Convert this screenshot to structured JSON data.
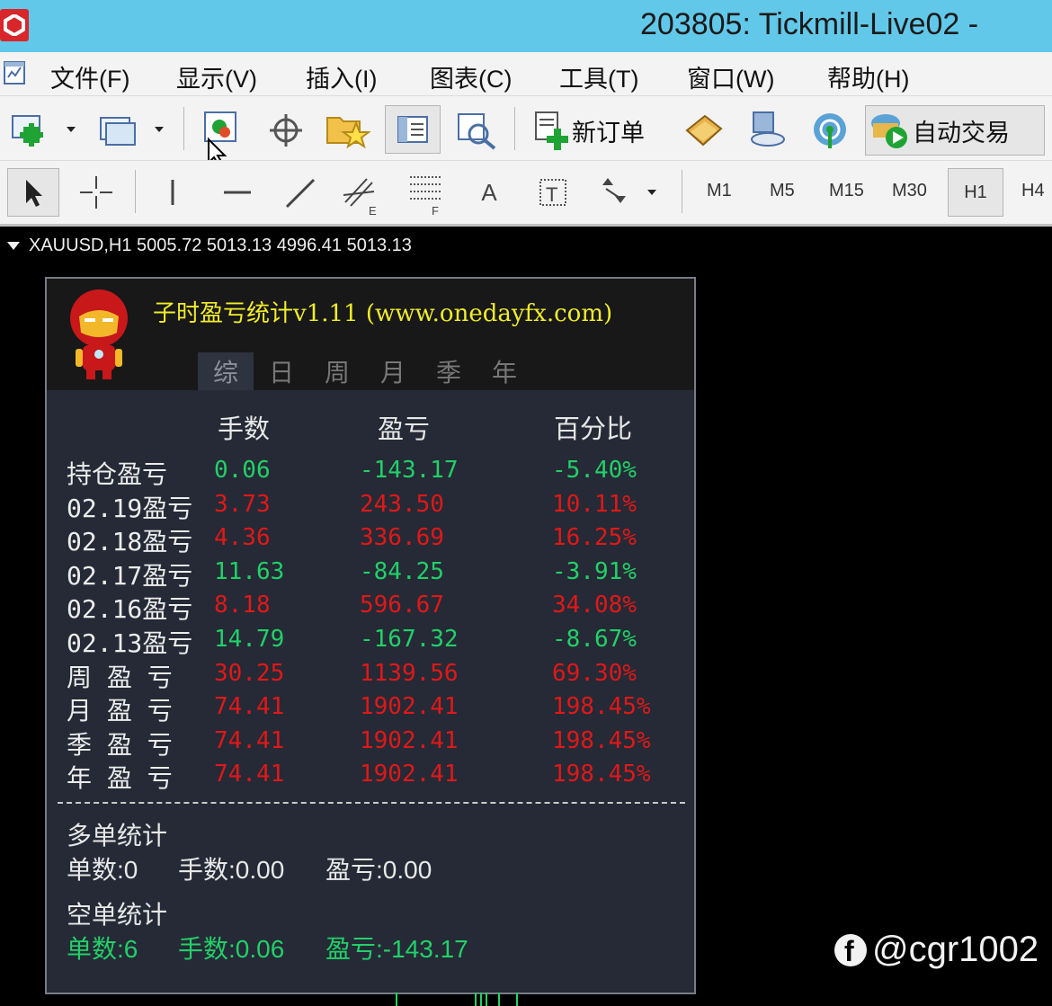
{
  "window": {
    "title": "203805: Tickmill-Live02 -"
  },
  "menu": {
    "items": [
      {
        "label": "文件(F)"
      },
      {
        "label": "显示(V)"
      },
      {
        "label": "插入(I)"
      },
      {
        "label": "图表(C)"
      },
      {
        "label": "工具(T)"
      },
      {
        "label": "窗口(W)"
      },
      {
        "label": "帮助(H)"
      }
    ]
  },
  "toolbar": {
    "new_order_label": "新订单",
    "auto_trade_label": "自动交易",
    "text_tool_label": "A",
    "timeframes": [
      "M1",
      "M5",
      "M15",
      "M30",
      "H1",
      "H4"
    ],
    "active_timeframe": "H1"
  },
  "chart": {
    "header": "XAUUSD,H1  5005.72 5013.13 4996.41 5013.13"
  },
  "panel": {
    "title": "子时盈亏统计v1.11 (www.onedayfx.com)",
    "tabs": [
      "综",
      "日",
      "周",
      "月",
      "季",
      "年"
    ],
    "active_tab": "综",
    "columns": [
      "手数",
      "盈亏",
      "百分比"
    ],
    "rows": [
      {
        "label": "持仓盈亏",
        "lots": "0.06",
        "pnl": "-143.17",
        "pct": "-5.40%",
        "dir": "up"
      },
      {
        "label": "02.19盈亏",
        "lots": "3.73",
        "pnl": "243.50",
        "pct": "10.11%",
        "dir": "dn"
      },
      {
        "label": "02.18盈亏",
        "lots": "4.36",
        "pnl": "336.69",
        "pct": "16.25%",
        "dir": "dn"
      },
      {
        "label": "02.17盈亏",
        "lots": "11.63",
        "pnl": "-84.25",
        "pct": "-3.91%",
        "dir": "up"
      },
      {
        "label": "02.16盈亏",
        "lots": "8.18",
        "pnl": "596.67",
        "pct": "34.08%",
        "dir": "dn"
      },
      {
        "label": "02.13盈亏",
        "lots": "14.79",
        "pnl": "-167.32",
        "pct": "-8.67%",
        "dir": "up"
      },
      {
        "label": "周 盈 亏",
        "lots": "30.25",
        "pnl": "1139.56",
        "pct": "69.30%",
        "dir": "dn"
      },
      {
        "label": "月 盈 亏",
        "lots": "74.41",
        "pnl": "1902.41",
        "pct": "198.45%",
        "dir": "dn"
      },
      {
        "label": "季 盈 亏",
        "lots": "74.41",
        "pnl": "1902.41",
        "pct": "198.45%",
        "dir": "dn"
      },
      {
        "label": "年 盈 亏",
        "lots": "74.41",
        "pnl": "1902.41",
        "pct": "198.45%",
        "dir": "dn"
      }
    ],
    "long_stats": {
      "title": "多单统计",
      "count": "单数:0",
      "lots": "手数:0.00",
      "pnl": "盈亏:0.00"
    },
    "short_stats": {
      "title": "空单统计",
      "count": "单数:6",
      "lots": "手数:0.06",
      "pnl": "盈亏:-143.17"
    }
  },
  "watermark": {
    "text": "@cgr1002"
  },
  "colors": {
    "profit": "#e01818",
    "loss": "#22d068",
    "title_yellow": "#f0ec2a",
    "titlebar": "#62c8e9"
  }
}
